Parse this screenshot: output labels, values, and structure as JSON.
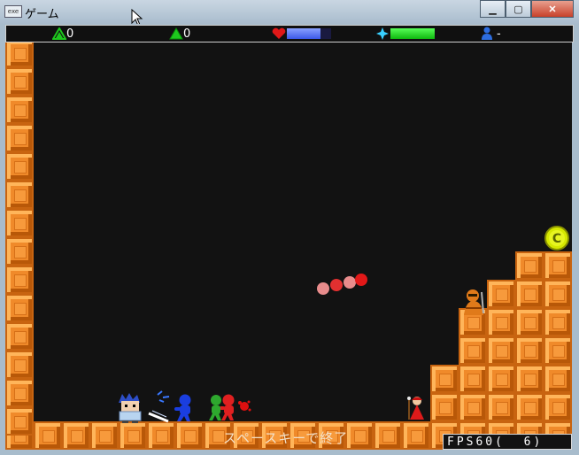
{
  "window": {
    "title": "ゲーム",
    "icon_text": "exe",
    "buttons": [
      "minimize",
      "maximize",
      "close"
    ]
  },
  "hud": {
    "green_count_1": "0",
    "green_count_2": "0",
    "health_fill": 0.75,
    "magic_fill": 1.0,
    "player_value": "-",
    "colors": {
      "health": "#4e6cff",
      "magic": "#18d81a",
      "heart": "#e01818",
      "sparkle": "#39d0ff",
      "person": "#2d6de0"
    }
  },
  "game": {
    "exit_hint": "スペースキーで終了",
    "fps_text": "FPS60(  6)",
    "coin_label": "C",
    "sprites": [
      "hero-blue-hair",
      "slash-effect",
      "blue-ninja",
      "green-runner",
      "red-runner",
      "red-spark",
      "red-mage",
      "orange-monk",
      "coin",
      "red-orb-chain"
    ]
  }
}
